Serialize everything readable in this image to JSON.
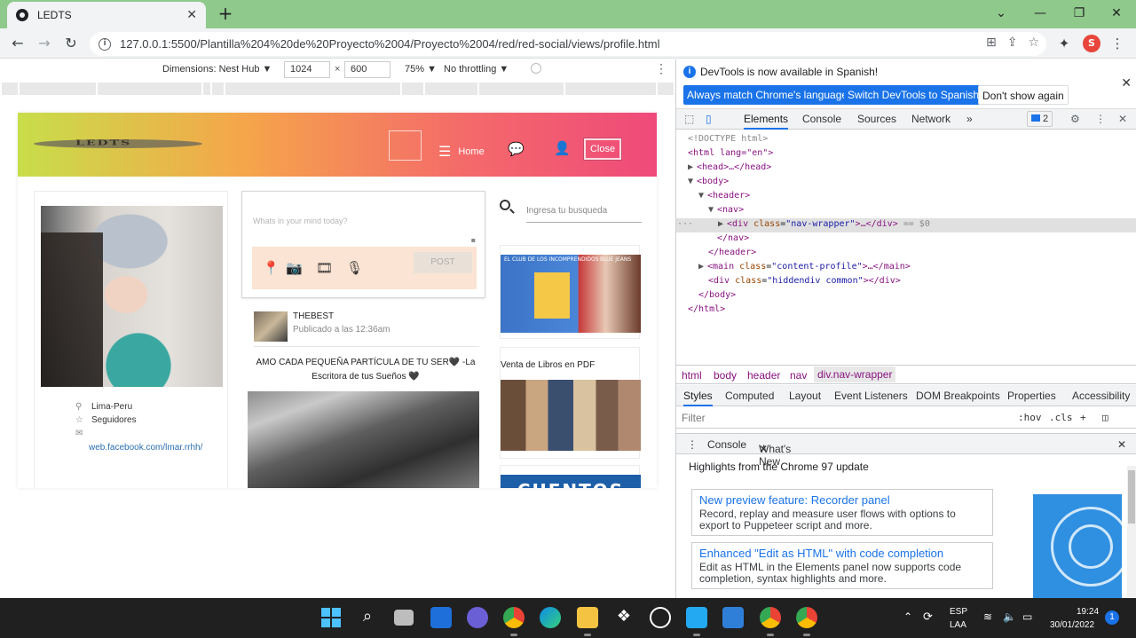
{
  "browser": {
    "tab_title": "LEDTS",
    "url": "127.0.0.1:5500/Plantilla%204%20de%20Proyecto%2004/Proyecto%2004/red/red-social/views/profile.html",
    "profile_initial": "S"
  },
  "device_toolbar": {
    "dimensions_label": "Dimensions: Nest Hub ▼",
    "width": "1024",
    "height": "600",
    "zoom": "75% ▼",
    "throttling": "No throttling ▼"
  },
  "site": {
    "logo_text": "LEDTS",
    "nav": {
      "home": "Home",
      "close": "Close"
    },
    "profile": {
      "location": "Lima-Peru",
      "followers": "Seguidores",
      "link": "web.facebook.com/lmar.rrhh/"
    },
    "post_box": {
      "placeholder": "Whats in your mind today?",
      "button": "POST"
    },
    "feed": {
      "user": "THEBEST",
      "time": "Publicado a las 12:36am",
      "text": "AMO CADA PEQUEÑA PARTÍCULA DE TU SER🖤 -La Escritora de tus Sueños 🖤"
    },
    "search_placeholder": "Ingresa tu busqueda",
    "ads": {
      "ad1_left": "EL CLUB DE LOS INCOMPRENDIDOS",
      "ad1_right": "BLUE JEANS",
      "ad2_caption": "Venta de Libros en PDF",
      "ad3_text": "CUENTOS"
    }
  },
  "devtools": {
    "info_message": "DevTools is now available in Spanish!",
    "btn_match": "Always match Chrome's language",
    "btn_switch": "Switch DevTools to Spanish",
    "btn_dismiss": "Don't show again",
    "tabs": [
      "Elements",
      "Console",
      "Sources",
      "Network"
    ],
    "issues_count": "2",
    "dom": {
      "doctype": "<!DOCTYPE html>",
      "html_open": "<html lang=\"en\">",
      "head": "<head>…</head>",
      "body_open": "<body>",
      "header_open": "<header>",
      "nav_open": "<nav>",
      "div_tag": "div",
      "div_attr": "class",
      "div_val": "\"nav-wrapper\"",
      "div_rest": ">…</div>",
      "div_eq": "== $0",
      "nav_close": "</nav>",
      "header_close": "</header>",
      "main_val": "\"content-profile\"",
      "main_rest": ">…</main>",
      "hidden_val": "\"hiddendiv common\"",
      "hidden_rest": "></div>",
      "body_close": "</body>",
      "html_close": "</html>"
    },
    "breadcrumbs": [
      "html",
      "body",
      "header",
      "nav",
      "div.nav-wrapper"
    ],
    "sub_tabs": [
      "Styles",
      "Computed",
      "Layout",
      "Event Listeners",
      "DOM Breakpoints",
      "Properties",
      "Accessibility"
    ],
    "filter_placeholder": "Filter",
    "filter_hov": ":hov",
    "filter_cls": ".cls",
    "drawer": {
      "console": "Console",
      "whats_new": "What's New",
      "highlights": "Highlights from the Chrome 97 update",
      "cards": [
        {
          "title": "New preview feature: Recorder panel",
          "desc": "Record, replay and measure user flows with options to export to Puppeteer script and more."
        },
        {
          "title": "Enhanced \"Edit as HTML\" with code completion",
          "desc": "Edit as HTML in the Elements panel now supports code completion, syntax highlights and more."
        }
      ]
    }
  },
  "taskbar": {
    "lang1": "ESP",
    "lang2": "LAA",
    "time": "19:24",
    "date": "30/01/2022",
    "notif": "1"
  }
}
